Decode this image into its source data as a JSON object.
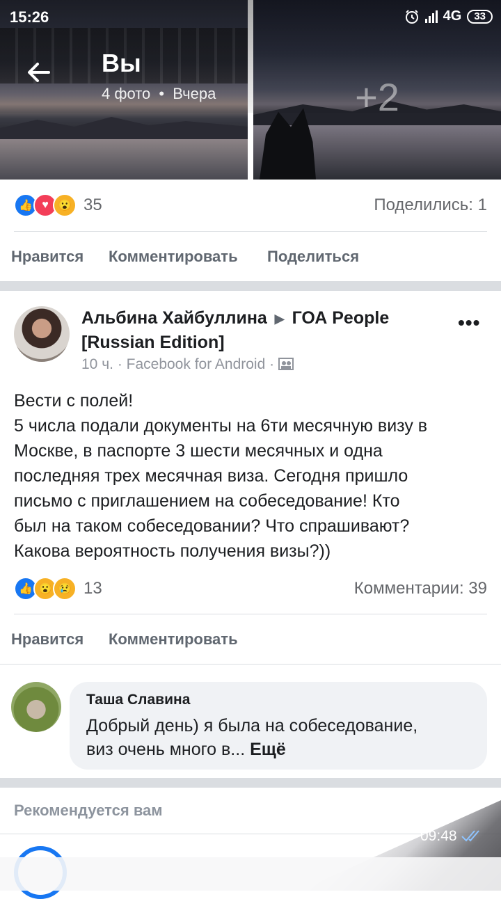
{
  "status_bar": {
    "time": "15:26",
    "network": "4G",
    "battery": "33"
  },
  "header": {
    "title": "Вы",
    "subtitle": "4 фото",
    "date": "Вчера",
    "photo_more": "+2"
  },
  "post1": {
    "reaction_count": "35",
    "shares": "Поделились: 1",
    "actions": [
      "Нравится",
      "Комментировать",
      "Поделиться"
    ]
  },
  "post2": {
    "author": "Альбина Хайбуллина",
    "group": "ГОА People [Russian Edition]",
    "time": "10 ч.",
    "source": "Facebook for Android",
    "more": "•••",
    "text_lines": [
      "Вести с полей!",
      "5 числа подали документы на 6ти месячную визу в",
      "Москве, в паспорте 3 шести месячных и одна",
      "последняя трех месячная виза. Сегодня пришло",
      "письмо с приглашением на собеседование! Кто",
      "был на таком собеседовании? Что спрашивают?",
      "Какова вероятность получения визы?))"
    ],
    "reaction_count": "13",
    "comments": "Комментарии: 39",
    "actions": [
      "Нравится",
      "Комментировать"
    ]
  },
  "comment": {
    "name": "Таша Славина",
    "line1": "Добрый день) я была на собеседование,",
    "line2": "виз очень много в...",
    "more": "Ещё"
  },
  "recommended": {
    "label": "Рекомендуется вам"
  },
  "overlay": {
    "timestamp": "09:48"
  },
  "icons": {
    "back": "back-arrow-icon",
    "alarm": "alarm-icon",
    "signal": "signal-icon",
    "like": "like-reaction-icon",
    "love": "love-reaction-icon",
    "wow": "wow-reaction-icon",
    "sad": "sad-reaction-icon",
    "privacy": "group-privacy-icon"
  },
  "colors": {
    "like_blue": "#1877f2",
    "love_red": "#f33e58",
    "wow_yellow": "#f7b125",
    "divider": "#dadde1"
  }
}
